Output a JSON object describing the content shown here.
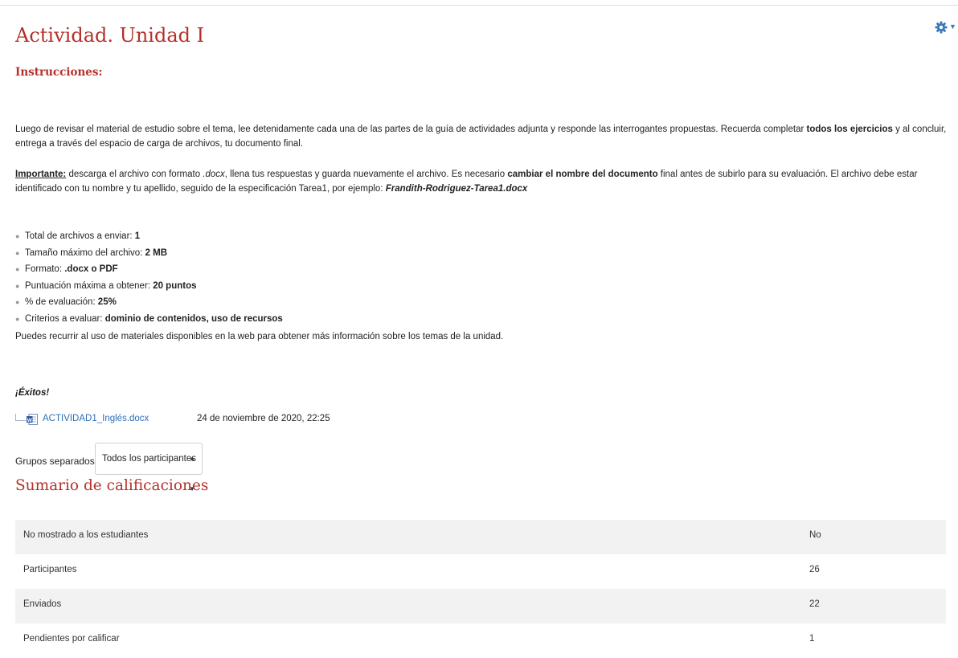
{
  "page": {
    "title": "Actividad. Unidad I",
    "instructions_heading": "Instrucciones:"
  },
  "intro": {
    "part1": "Luego de revisar el material de estudio sobre el tema, lee detenidamente cada una de las partes de la guía de actividades adjunta y responde las interrogantes propuestas. Recuerda completar ",
    "bold1": "todos los ejercicios",
    "part2": " y al concluir, entrega a través del espacio de carga de archivos, tu documento final."
  },
  "important": {
    "label": "Importante:",
    "t1": " descarga el archivo con formato ",
    "ext": ".docx",
    "t2": ", llena tus respuestas y guarda nuevamente el archivo. Es necesario ",
    "bold": "cambiar el nombre del documento",
    "t3": " final antes de subirlo para su evaluación. El archivo debe estar identificado con tu nombre y tu apellido, seguido de la especificación Tarea1, por ejemplo: ",
    "example": "Frandith-Rodriguez-Tarea1.docx"
  },
  "requirements": [
    {
      "label": "Total de archivos a enviar: ",
      "value": "1"
    },
    {
      "label": "Tamaño máximo del archivo: ",
      "value": "2 MB"
    },
    {
      "label": "Formato: ",
      "value": ".docx o PDF"
    },
    {
      "label": "Puntuación máxima a obtener: ",
      "value": "20 puntos"
    },
    {
      "label": "% de evaluación: ",
      "value": "25%"
    },
    {
      "label": "Criterios a evaluar: ",
      "value": "dominio de contenidos, uso de recursos"
    }
  ],
  "closing": "Puedes recurrir al uso de materiales disponibles en la web para obtener más información sobre los temas de la unidad.",
  "exitos": "¡Éxitos!",
  "attachment": {
    "filename": "ACTIVIDAD1_Inglés.docx",
    "date": "24 de noviembre de 2020, 22:25",
    "icon": "word-document-icon"
  },
  "groups": {
    "label": "Grupos separados",
    "selected": "Todos los participantes"
  },
  "summary": {
    "title": "Sumario de calificaciones",
    "rows": [
      {
        "label": "No mostrado a los estudiantes",
        "value": "No"
      },
      {
        "label": "Participantes",
        "value": "26"
      },
      {
        "label": "Enviados",
        "value": "22"
      },
      {
        "label": "Pendientes por calificar",
        "value": "1"
      }
    ]
  },
  "colors": {
    "heading": "#b5302a",
    "link": "#2e6fb5",
    "gear": "#3b78b8",
    "row_stripe": "#f2f2f2"
  },
  "icons": {
    "settings": "gear-icon",
    "bullet": "bullet-icon",
    "select_arrows": "sort-arrows-icon"
  }
}
